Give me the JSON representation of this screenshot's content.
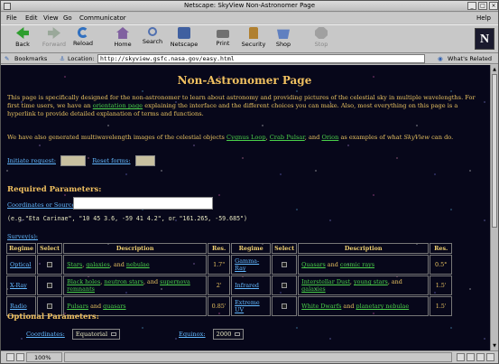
{
  "window": {
    "title": "Netscape: SkyView Non-Astronomer Page"
  },
  "menubar": {
    "items": [
      "File",
      "Edit",
      "View",
      "Go",
      "Communicator"
    ],
    "help": "Help"
  },
  "toolbar": {
    "buttons": [
      {
        "label": "Back",
        "icon": "back-arrow-icon",
        "color": "#2e9e2e"
      },
      {
        "label": "Forward",
        "icon": "forward-arrow-icon",
        "color": "#9aa89a"
      },
      {
        "label": "Reload",
        "icon": "reload-icon",
        "color": "#3070c0"
      },
      {
        "label": "Home",
        "icon": "home-icon",
        "color": "#8060a0"
      },
      {
        "label": "Search",
        "icon": "search-icon",
        "color": "#5070b0"
      },
      {
        "label": "Netscape",
        "icon": "netscape-icon",
        "color": "#4060a0"
      },
      {
        "label": "Print",
        "icon": "print-icon",
        "color": "#707070"
      },
      {
        "label": "Security",
        "icon": "security-icon",
        "color": "#b08030"
      },
      {
        "label": "Shop",
        "icon": "shop-icon",
        "color": "#6080c0"
      },
      {
        "label": "Stop",
        "icon": "stop-icon",
        "color": "#a0a0a0"
      }
    ],
    "logo": "N"
  },
  "location": {
    "bookmarks": "Bookmarks",
    "label": "Location:",
    "url": "http://skyview.gsfc.nasa.gov/easy.html",
    "related": "What's Related"
  },
  "page": {
    "heading": "Non-Astronomer Page",
    "intro_1": "This page is specifically designed for the non-astronomer to learn about astronomy and providing pictures of the celestial sky in multiple wavelengths. For first time users, we have an",
    "intro_link": "orientation page",
    "intro_2": "explaining the interface and the different choices you can make. Also, most everything on this page is a hyperlink to provide detailed explanation of terms and functions.",
    "multi_1": "We have also generated multiwavelength images of the celestial objects",
    "obj_1": "Cygnus Loop",
    "obj_2": "Crab Pulsar",
    "obj_3": "Orion",
    "multi_2": "as examples of what",
    "multi_app": "SkyView",
    "multi_3": "can do.",
    "initiate": "Initiate request:",
    "reset": "Reset forms:",
    "required": "Required Parameters:",
    "coord_label": "Coordinates or Source:",
    "coord_value": "",
    "example": "(e.g.\"Eta Carinae\", \"10 45 3.6, -59 41 4.2\", or \"161.265, -59.685\")",
    "survey_label": "Survey(s):",
    "table_headers": [
      "Regime",
      "Select",
      "Description",
      "Res.",
      "Regime",
      "Select",
      "Description",
      "Res."
    ],
    "rows": [
      {
        "r1": "Optical",
        "d1": [
          [
            "Stars",
            1
          ],
          [
            ", ",
            0
          ],
          [
            "galaxies",
            1
          ],
          [
            ", and ",
            0
          ],
          [
            "nebulae",
            1
          ]
        ],
        "res1": "1.7\"",
        "r2": "Gamma-Ray",
        "d2": [
          [
            "Quasars",
            1
          ],
          [
            " and ",
            0
          ],
          [
            "cosmic rays",
            1
          ]
        ],
        "res2": "0.5°"
      },
      {
        "r1": "X-Ray",
        "d1": [
          [
            "Black holes",
            1
          ],
          [
            ", ",
            0
          ],
          [
            "neutron stars",
            1
          ],
          [
            ", and ",
            0
          ],
          [
            "supernova remnants",
            1
          ]
        ],
        "res1": "2'",
        "r2": "Infrared",
        "d2": [
          [
            "Interstellar Dust",
            1
          ],
          [
            ", ",
            0
          ],
          [
            "young stars",
            1
          ],
          [
            ", and ",
            0
          ],
          [
            "galaxies",
            1
          ]
        ],
        "res2": "1.5'"
      },
      {
        "r1": "Radio",
        "d1": [
          [
            "Pulsars",
            1
          ],
          [
            " and ",
            0
          ],
          [
            "quasars",
            1
          ]
        ],
        "res1": "0.85'",
        "r2": "Extreme UV",
        "d2": [
          [
            "White Dwarfs",
            1
          ],
          [
            " and ",
            0
          ],
          [
            "planetary nebulae",
            1
          ]
        ],
        "res2": "1.5'"
      }
    ],
    "optional": "Optional Parameters:",
    "coords_opt": "Coordinates:",
    "coords_value": "Equatorial",
    "equinox": "Equinox:",
    "equinox_value": "2000"
  },
  "status": {
    "percent": "100%"
  }
}
